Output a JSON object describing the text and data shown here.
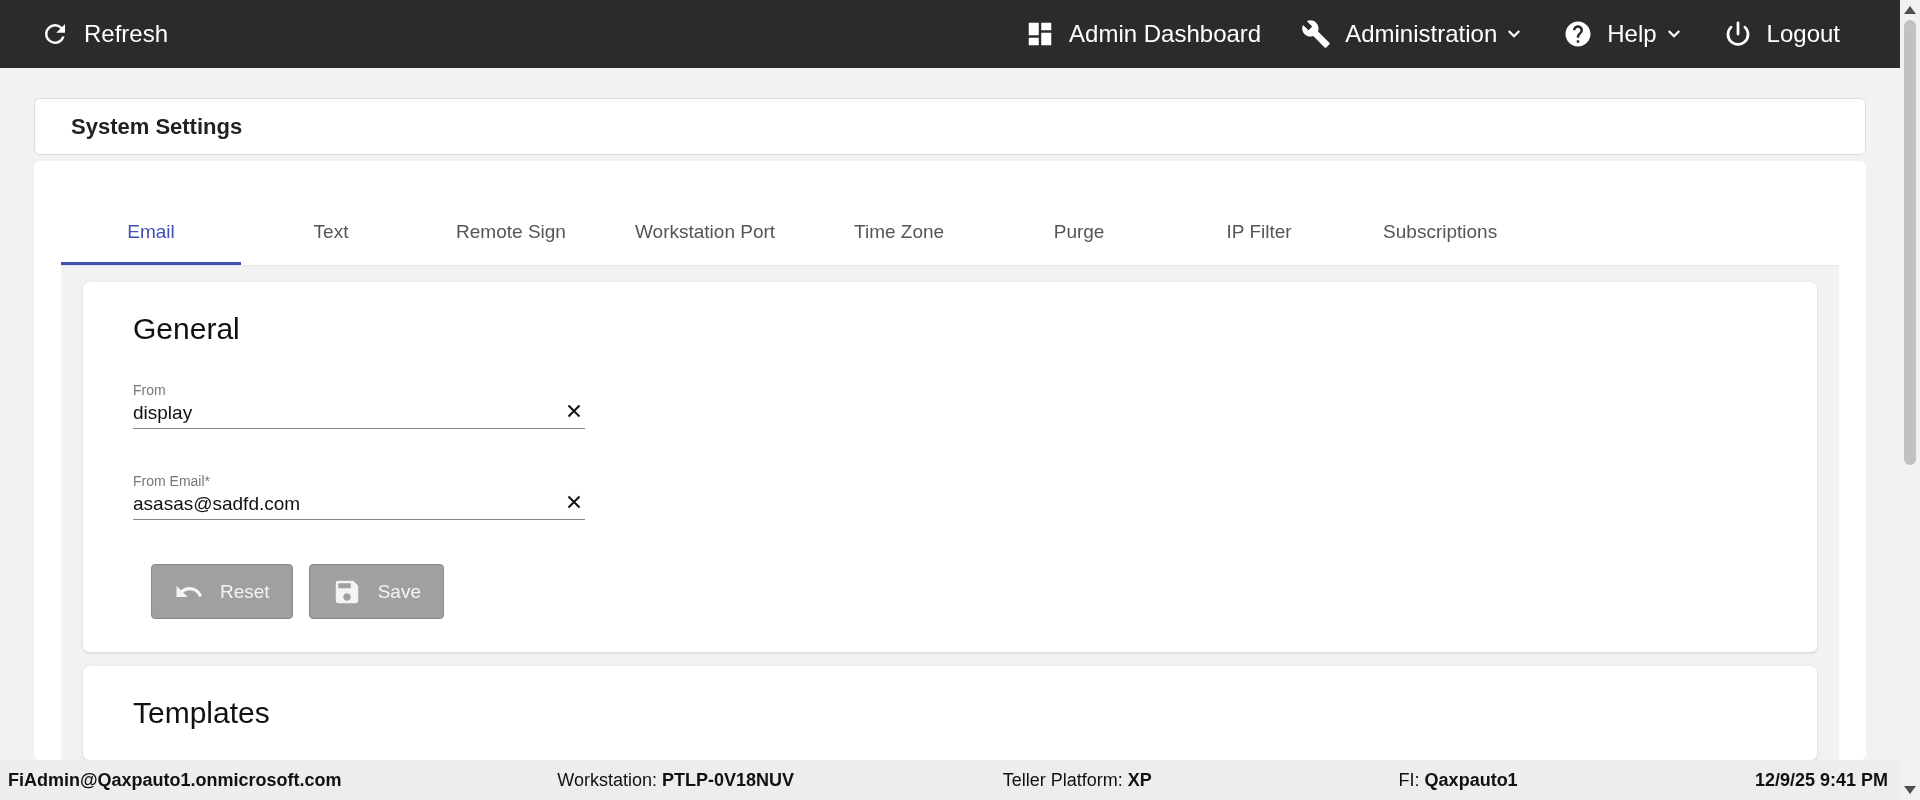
{
  "top_bar": {
    "refresh": "Refresh",
    "nav": [
      {
        "kind": "dashboard",
        "label": "Admin Dashboard",
        "dropdown": false
      },
      {
        "kind": "wrench",
        "label": "Administration",
        "dropdown": true
      },
      {
        "kind": "help",
        "label": "Help",
        "dropdown": true
      },
      {
        "kind": "power",
        "label": "Logout",
        "dropdown": false
      }
    ]
  },
  "page_title": "System Settings",
  "tabs": [
    {
      "label": "Email",
      "selected": true
    },
    {
      "label": "Text",
      "selected": false
    },
    {
      "label": "Remote Sign",
      "selected": false
    },
    {
      "label": "Workstation Port",
      "selected": false
    },
    {
      "label": "Time Zone",
      "selected": false
    },
    {
      "label": "Purge",
      "selected": false
    },
    {
      "label": "IP Filter",
      "selected": false
    },
    {
      "label": "Subscriptions",
      "selected": false
    }
  ],
  "general": {
    "title": "General",
    "fields": [
      {
        "label": "From",
        "value": "display"
      },
      {
        "label": "From Email*",
        "value": "asasas@sadfd.com"
      }
    ],
    "buttons": [
      {
        "kind": "reset",
        "label": "Reset",
        "disabled": true
      },
      {
        "kind": "save",
        "label": "Save",
        "disabled": true
      }
    ]
  },
  "templates": {
    "title": "Templates"
  },
  "status_bar": {
    "user": "FiAdmin@Qaxpauto1.onmicrosoft.com",
    "workstation": "Workstation: **PTLP-0V18NUV**",
    "platform": "Teller Platform: **XP**",
    "fi": "FI: **Qaxpauto1**",
    "datetime": "12/9/25 9:41 PM"
  }
}
